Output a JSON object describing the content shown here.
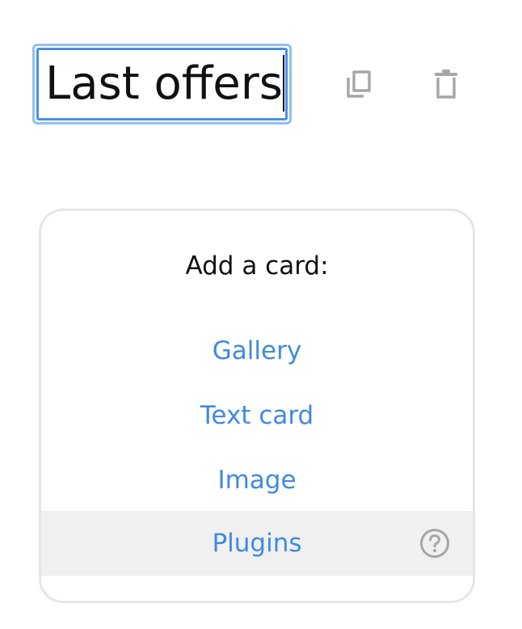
{
  "title": {
    "value": "Last offers"
  },
  "toolbar": {
    "copy_icon": "copy-icon",
    "delete_icon": "trash-icon"
  },
  "add_card": {
    "heading": "Add a card:",
    "options": [
      {
        "label": "Gallery"
      },
      {
        "label": "Text card"
      },
      {
        "label": "Image"
      },
      {
        "label": "Plugins",
        "help_icon": "help-icon"
      }
    ]
  },
  "colors": {
    "link": "#3f8ae0",
    "focus_ring": "#8fc0f5",
    "hover_row": "#f0f0f0",
    "icon": "#a6a6a6"
  }
}
